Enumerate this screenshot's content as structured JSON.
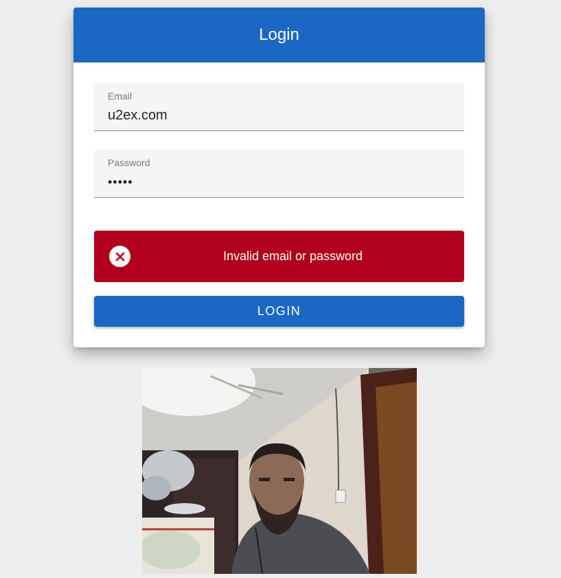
{
  "login_card": {
    "title": "Login",
    "email": {
      "label": "Email",
      "value": "u2ex.com"
    },
    "password": {
      "label": "Password",
      "value": "•••••"
    },
    "error": {
      "icon": "close-circle-icon",
      "message": "Invalid email or password"
    },
    "submit_label": "LOGIN"
  },
  "colors": {
    "primary": "#1a68c3",
    "error": "#b0001e",
    "background": "#eeeeee"
  },
  "webcam_preview": {
    "content": "webcam-video-feed"
  }
}
